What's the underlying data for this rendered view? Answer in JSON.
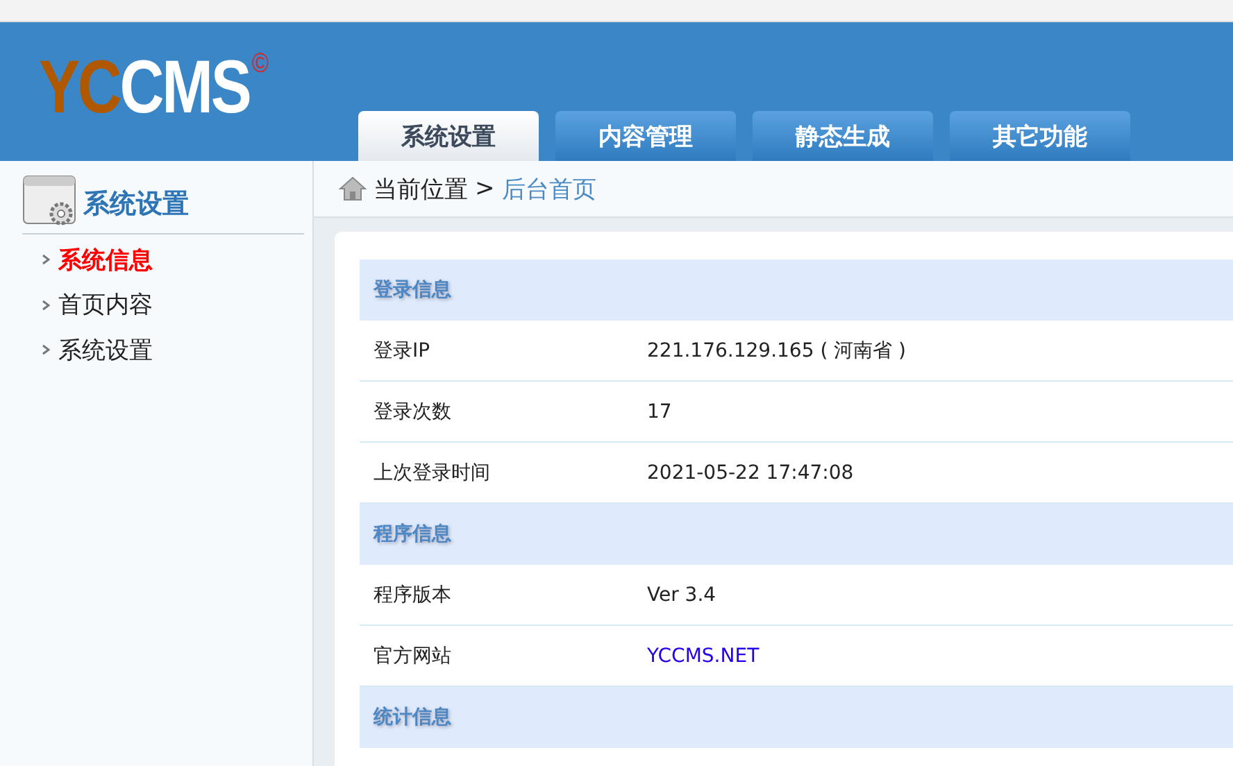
{
  "logo": {
    "part_1": "YC",
    "part_2": "CMS",
    "mark": "©"
  },
  "tabs": [
    {
      "label": "系统设置",
      "selected": true
    },
    {
      "label": "内容管理",
      "selected": false
    },
    {
      "label": "静态生成",
      "selected": false
    },
    {
      "label": "其它功能",
      "selected": false
    }
  ],
  "sidebar": {
    "title": "系统设置",
    "items": [
      {
        "label": "系统信息",
        "selected": true
      },
      {
        "label": "首页内容",
        "selected": false
      },
      {
        "label": "系统设置",
        "selected": false
      }
    ]
  },
  "breadcrumb": {
    "label": "当前位置",
    "separator": ">",
    "current": "后台首页"
  },
  "sections": [
    {
      "title": "登录信息",
      "rows": [
        {
          "label": "登录IP",
          "value": "221.176.129.165 ( 河南省 )",
          "kind": "text"
        },
        {
          "label": "登录次数",
          "value": "17",
          "kind": "text"
        },
        {
          "label": "上次登录时间",
          "value": "2021-05-22 17:47:08",
          "kind": "text"
        }
      ]
    },
    {
      "title": "程序信息",
      "rows": [
        {
          "label": "程序版本",
          "value": "Ver 3.4",
          "kind": "text"
        },
        {
          "label": "官方网站",
          "value": "YCCMS.NET",
          "kind": "link"
        }
      ]
    },
    {
      "title": "统计信息"
    }
  ]
}
